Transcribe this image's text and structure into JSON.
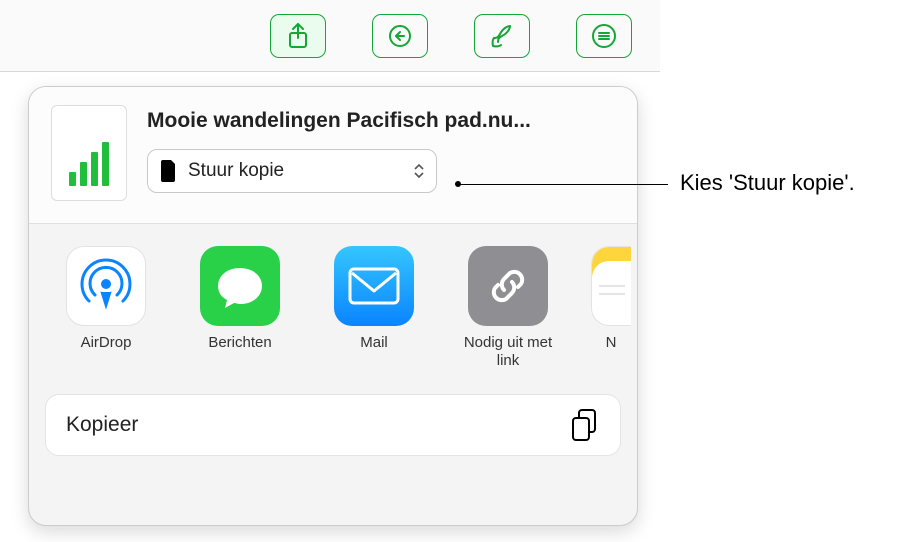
{
  "toolbar": {
    "share": "share-icon",
    "reply": "reply-icon",
    "brush": "brush-icon",
    "more": "more-menu-icon"
  },
  "sheet": {
    "doc_title": "Mooie wandelingen Pacifisch pad.nu...",
    "mode_label": "Stuur kopie",
    "targets": [
      {
        "id": "airdrop",
        "label": "AirDrop"
      },
      {
        "id": "berichten",
        "label": "Berichten"
      },
      {
        "id": "mail",
        "label": "Mail"
      },
      {
        "id": "link",
        "label": "Nodig uit met link"
      },
      {
        "id": "notes",
        "label": "N"
      }
    ],
    "copy_label": "Kopieer"
  },
  "callout": {
    "text": "Kies 'Stuur kopie'."
  }
}
